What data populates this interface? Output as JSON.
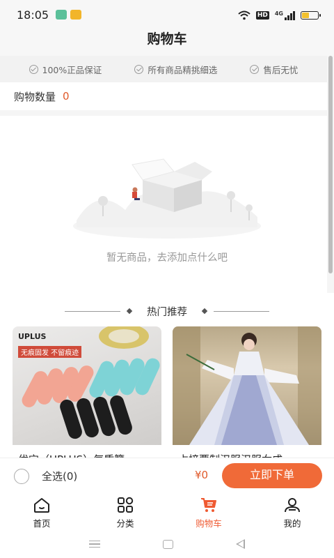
{
  "status_bar": {
    "time": "18:05",
    "signal_label": "4G"
  },
  "header": {
    "title": "购物车"
  },
  "guarantees": [
    {
      "label": "100%正品保证",
      "icon": "check-circle-icon"
    },
    {
      "label": "所有商品精挑细选",
      "icon": "check-circle-icon"
    },
    {
      "label": "售后无忧",
      "icon": "check-circle-icon"
    }
  ],
  "cart": {
    "count_label": "购物数量",
    "count_value": "0"
  },
  "empty_state": {
    "message": "暂无商品，去添加点什么吧"
  },
  "hot_recommend": {
    "title": "热门推荐",
    "products": [
      {
        "name": "优宝（UPLUS）气质簪",
        "brand": "UPLUS",
        "tag": "无痕固发 不留痕迹"
      },
      {
        "name": "占榜要制汉服汉服女成"
      }
    ]
  },
  "bottom_bar": {
    "select_all_label": "全选(0)",
    "total_price": "¥0",
    "checkout_label": "立即下单"
  },
  "tabs": [
    {
      "label": "首页",
      "icon": "home-icon",
      "active": false
    },
    {
      "label": "分类",
      "icon": "grid-icon",
      "active": false
    },
    {
      "label": "购物车",
      "icon": "cart-icon",
      "active": true
    },
    {
      "label": "我的",
      "icon": "user-icon",
      "active": false
    }
  ],
  "colors": {
    "accent": "#f06a38",
    "price": "#e0592a",
    "active_tab": "#ef5a32"
  }
}
